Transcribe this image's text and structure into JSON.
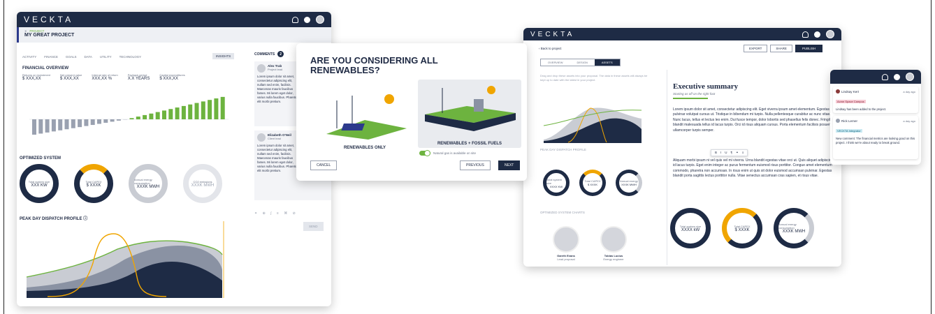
{
  "brand": "VECKTA",
  "dashboard": {
    "breadcrumb": "PROJECT",
    "project_title": "MY GREAT PROJECT",
    "tabs": [
      "ACTIVITY",
      "FINANCE",
      "GOALS",
      "DATA",
      "UTILITY",
      "TECHNOLOGY"
    ],
    "insights_tab": "INSIGHTS",
    "financial_title": "FINANCIAL OVERVIEW",
    "metrics": [
      {
        "label": "Returns on investment",
        "value": "$ XXX,XX"
      },
      {
        "label": "Net present value",
        "value": "$ XXX,XX"
      },
      {
        "label": "Internal rate of return",
        "value": "XXX,XX %"
      },
      {
        "label": "Payback period",
        "value": "X.X YEARS"
      },
      {
        "label": "Capital expenditures",
        "value": "$ XXX,XX"
      }
    ],
    "system_title": "OPTIMIZED SYSTEM",
    "donuts": [
      {
        "label": "Total system size",
        "value": "XXX KW"
      },
      {
        "label": "Total CAPEX",
        "value": "$ XXXK"
      },
      {
        "label": "Annual energy consumption",
        "value": "XXXK MWH"
      },
      {
        "label": "CO2 emissions",
        "value": "XXXK MWH"
      }
    ],
    "dispatch_title": "PEAK DAY DISPATCH PROFILE",
    "comments_title": "COMMENTS",
    "comments_count": "2",
    "comments": [
      {
        "name": "Alex Trab",
        "role": "Project lead",
        "text": "Lorem ipsum dolor sit amet, consectetur adipiscing elit, nullam sed enim, facilisis. Maecenas mauris faucibus fames. Mi lorem eget dolor, varius nulla faucibus. Pharetra elit morbi pretium."
      },
      {
        "name": "Elizabeth O'Neil",
        "role": "Client lead",
        "text": "Lorem ipsum dolor sit amet, consectetur adipiscing elit, nullam sed enim, facilisis. Maecenas mauris faucibus fames. Mi lorem eget dolor, varius nulla faucibus. Pharetra elit morbi pretium."
      }
    ],
    "send_label": "SEND"
  },
  "wizard": {
    "title": "ARE YOU CONSIDERING ALL RENEWABLES?",
    "option_a": "RENEWABLES ONLY",
    "option_b": "RENEWABLES + FOSSIL FUELS",
    "toggle_label": "Natural gas is available on site",
    "cancel": "CANCEL",
    "previous": "PREVIOUS",
    "next": "NEXT"
  },
  "report": {
    "back": "Back to project",
    "export": "EXPORT",
    "share": "SHARE",
    "publish": "PUBLISH",
    "tabs": [
      "OVERVIEW",
      "DESIGN",
      "ASSETS"
    ],
    "drag_hint": "Drag and drop these assets into your proposal. The data in these assets will always be kept up to date with the latest in your project.",
    "peak_label": "PEAK DAY DISPATCH PROFILE",
    "mini_donuts": [
      {
        "label": "Total system size",
        "value": "XXXX KW"
      },
      {
        "label": "Total CAPEX",
        "value": "$ XXXK"
      },
      {
        "label": "Annual energy",
        "value": "XXXK MWH"
      }
    ],
    "charts_label": "OPTIMIZED SYSTEM CHARTS",
    "people": [
      {
        "name": "Gareth Evans",
        "role": "Lead proposal"
      },
      {
        "name": "Tobias Lucius",
        "role": "Energy engineer"
      }
    ],
    "exec_title": "Executive summary",
    "exec_sub": "Starting as off on the right foot",
    "para1": "Lorem ipsum dolor sit amet, consectetur adipiscing elit. Eget viverra ipsum amet elementum. Egestas pulvinar volutpat cursus ut. Tristique in bibendum mi turpis. Nulla pellentesque curabitur ac nunc vitae. Nunc lacus, tellus et lectus leo enim. Dui fusce tempor, dolor lobortis sed phasellus felis donec. Fringilla blandit malesuada tellus id lacus turpis. Orci id risus aliquam cursus. Porta elementum facilisis posuere ullamcorper turpis semper.",
    "para2": "Aliquam morbi ipsum ni vel quis vel mi viverra. Urna blandit egestas vitae orci ut. Quis aliquet adipiscing id lacus turpis. Eget enim integer ac purus fermentum euismod risus porttitor. Congue amet elementum commodo, pharetra non accumsan. In risus enim ut quis sit dolor euismod accumsan pulvinar. Egestas blandit porta sagittis lectus porttitor nulla. Vitae senectus accumsan cras sapien, et risus vitae.",
    "big_donuts": [
      {
        "label": "Total system size",
        "value": "XXXX kW"
      },
      {
        "label": "Total CAPEX",
        "value": "$ XXXK"
      },
      {
        "label": "Annual energy consumption",
        "value": "XXXK MWH"
      }
    ]
  },
  "notifications": [
    {
      "name": "Lindsay Kert",
      "time": "a day ago",
      "tag": "Acme Space Campus",
      "text": "Lindsay has been added to the project."
    },
    {
      "name": "Rick Lerner",
      "time": "a day ago",
      "tag": "VECKTA Integrator",
      "text": "New comment: The financial metrics are looking good on this project. I think we're about ready to break ground."
    }
  ],
  "colors": {
    "navy": "#1e2b45",
    "green": "#6db33f",
    "amber": "#f0a500",
    "grey": "#c9ccd3"
  }
}
